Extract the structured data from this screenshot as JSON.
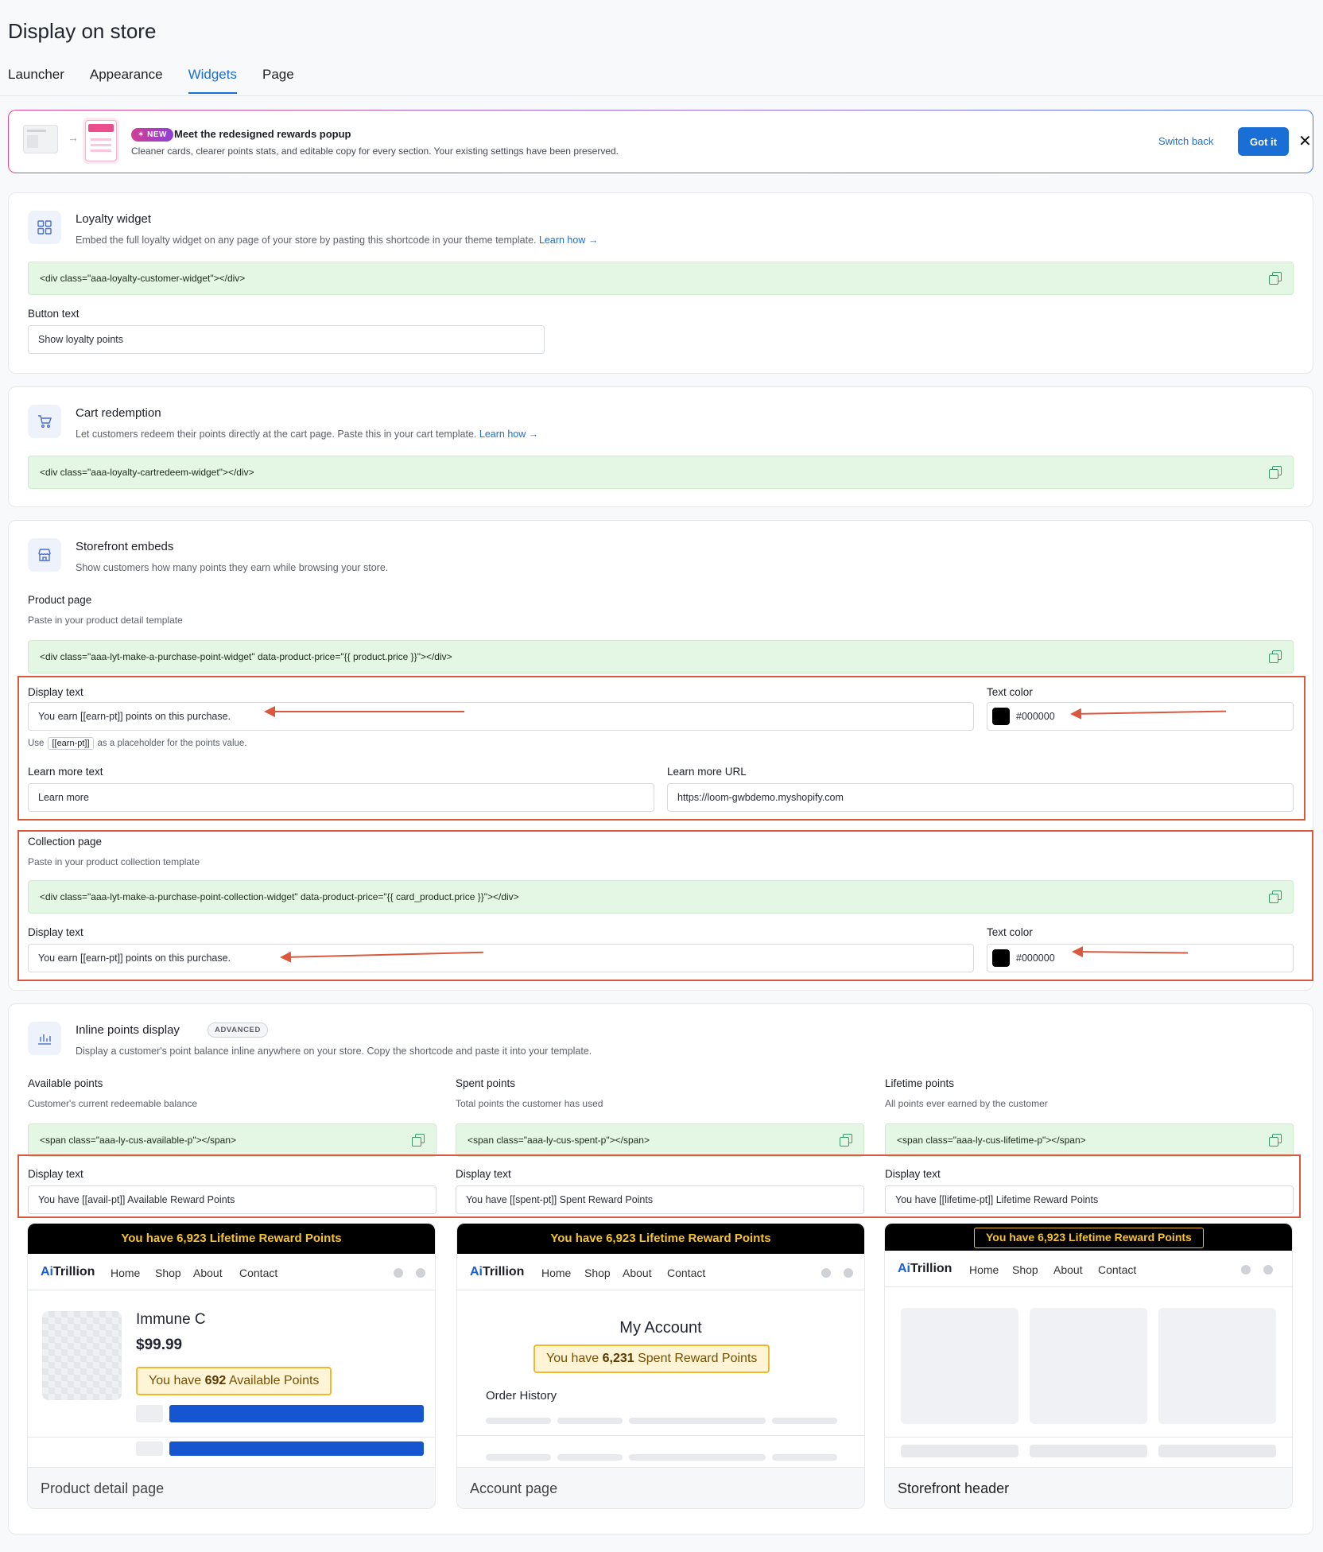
{
  "page": {
    "title": "Display on store",
    "tabs": [
      {
        "label": "Launcher"
      },
      {
        "label": "Appearance"
      },
      {
        "label": "Widgets"
      },
      {
        "label": "Page"
      }
    ]
  },
  "banner": {
    "badge": "✶ NEW",
    "title": "Meet the redesigned rewards popup",
    "description": "Cleaner cards, clearer points stats, and editable copy for every section. Your existing settings have been preserved.",
    "switch_back": "Switch back",
    "got_it": "Got it",
    "close": "✕"
  },
  "loyalty_widget": {
    "title": "Loyalty widget",
    "description": "Embed the full loyalty widget on any page of your store by pasting this shortcode in your theme template.",
    "link": "Learn how →",
    "code": "<div class=\"aaa-loyalty-customer-widget\"></div>",
    "button_text_label": "Button text",
    "button_text_value": "Show loyalty points"
  },
  "cart_redemption": {
    "title": "Cart redemption",
    "description": "Let customers redeem their points directly at the cart page. Paste this in your cart template.",
    "link": "Learn how →",
    "code": "<div class=\"aaa-loyalty-cartredeem-widget\"></div>"
  },
  "storefront_embeds": {
    "title": "Storefront embeds",
    "description": "Show customers how many points they earn while browsing your store.",
    "product_page": {
      "label": "Product page",
      "sublabel": "Paste in your product detail template",
      "code": "<div class=\"aaa-lyt-make-a-purchase-point-widget\" data-product-price=\"{{ product.price }}\"></div>",
      "display_text_label": "Display text",
      "display_text_value": "You earn [[earn-pt]] points on this purchase.",
      "text_color_label": "Text color",
      "text_color_value": "#000000",
      "hint_prefix": "Use",
      "hint_code": "[[earn-pt]]",
      "hint_suffix": "as a placeholder for the points value.",
      "learn_more_text_label": "Learn more text",
      "learn_more_text_value": "Learn more",
      "learn_more_url_label": "Learn more URL",
      "learn_more_url_value": "https://loom-gwbdemo.myshopify.com"
    },
    "collection_page": {
      "label": "Collection page",
      "sublabel": "Paste in your product collection template",
      "code": "<div class=\"aaa-lyt-make-a-purchase-point-collection-widget\" data-product-price=\"{{ card_product.price }}\"></div>",
      "display_text_label": "Display text",
      "display_text_value": "You earn [[earn-pt]] points on this purchase.",
      "text_color_label": "Text color",
      "text_color_value": "#000000"
    }
  },
  "inline_points": {
    "title": "Inline points display",
    "badge": "ADVANCED",
    "description": "Display a customer's point balance inline anywhere on your store. Copy the shortcode and paste it into your template.",
    "columns": [
      {
        "label": "Available points",
        "sublabel": "Customer's current redeemable balance",
        "code": "<span class=\"aaa-ly-cus-available-p\"></span>",
        "display_text_label": "Display text",
        "display_text_value": "You have [[avail-pt]] Available Reward Points"
      },
      {
        "label": "Spent points",
        "sublabel": "Total points the customer has used",
        "code": "<span class=\"aaa-ly-cus-spent-p\"></span>",
        "display_text_label": "Display text",
        "display_text_value": "You have [[spent-pt]] Spent Reward Points"
      },
      {
        "label": "Lifetime points",
        "sublabel": "All points ever earned by the customer",
        "code": "<span class=\"aaa-ly-cus-lifetime-p\"></span>",
        "display_text_label": "Display text",
        "display_text_value": "You have [[lifetime-pt]] Lifetime Reward Points"
      }
    ]
  },
  "previews": {
    "brand_ai": "Ai",
    "brand_rest": "Trillion",
    "nav": [
      "Home",
      "Shop",
      "About",
      "Contact"
    ],
    "product": {
      "banner": "You have 6,923 Lifetime Reward Points",
      "name": "Immune C",
      "price": "$99.99",
      "pill_prefix": "You have",
      "pill_number": "692",
      "pill_suffix": "Available Points",
      "footer": "Product detail page"
    },
    "account": {
      "banner": "You have 6,923 Lifetime Reward Points",
      "heading": "My Account",
      "pill_prefix": "You have",
      "pill_number": "6,231",
      "pill_suffix": "Spent Reward Points",
      "order_history": "Order History",
      "footer": "Account page"
    },
    "storefront": {
      "banner": "You have 6,923 Lifetime Reward Points",
      "footer": "Storefront header"
    }
  },
  "colors": {
    "accent": "#1a6fd6",
    "annotation": "#d9583e",
    "code_bg": "#e4f6e4",
    "gold": "#f5c32a"
  },
  "icons": [
    "grid-icon",
    "cart-icon",
    "store-icon",
    "bar-chart-icon",
    "copy-icon",
    "close-icon"
  ]
}
